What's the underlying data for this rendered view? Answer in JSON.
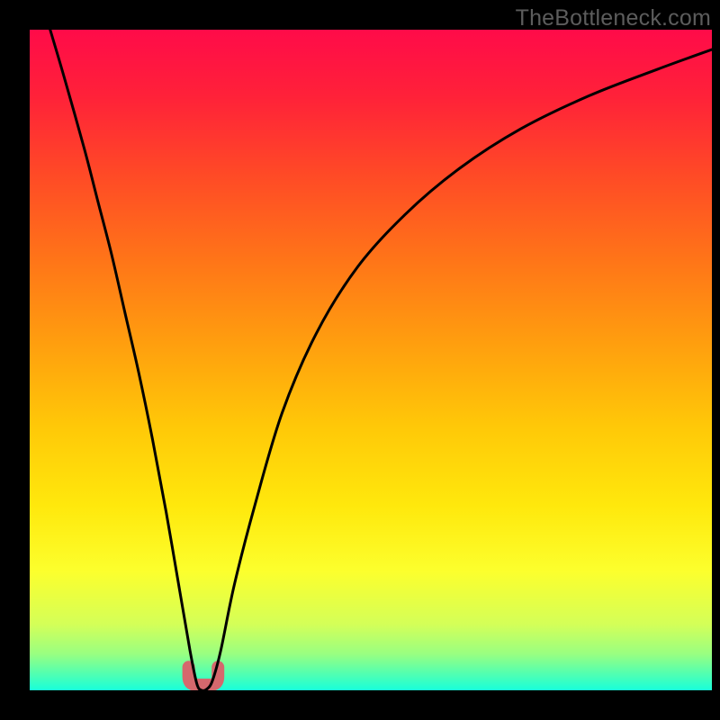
{
  "watermark": "TheBottleneck.com",
  "colors": {
    "gradient_stops": [
      {
        "offset": 0.0,
        "color": "#ff0b49"
      },
      {
        "offset": 0.1,
        "color": "#ff2139"
      },
      {
        "offset": 0.22,
        "color": "#ff4a26"
      },
      {
        "offset": 0.35,
        "color": "#ff7518"
      },
      {
        "offset": 0.48,
        "color": "#ffa00e"
      },
      {
        "offset": 0.6,
        "color": "#ffc808"
      },
      {
        "offset": 0.72,
        "color": "#ffe80c"
      },
      {
        "offset": 0.82,
        "color": "#fcff2d"
      },
      {
        "offset": 0.9,
        "color": "#d4ff58"
      },
      {
        "offset": 0.945,
        "color": "#99ff81"
      },
      {
        "offset": 0.97,
        "color": "#5dffa9"
      },
      {
        "offset": 1.0,
        "color": "#18ffda"
      }
    ],
    "curve": "#000000",
    "highlight": "#d5686d",
    "frame": "#000000"
  },
  "chart_data": {
    "type": "line",
    "title": "",
    "xlabel": "",
    "ylabel": "",
    "xlim": [
      0,
      100
    ],
    "ylim": [
      0,
      100
    ],
    "grid": false,
    "legend": false,
    "series": [
      {
        "name": "bottleneck-curve",
        "x": [
          3,
          5,
          8,
          10,
          12,
          14,
          16,
          18,
          20,
          22,
          23.5,
          24.5,
          25.2,
          26.0,
          26.8,
          28,
          30,
          33,
          37,
          42,
          48,
          55,
          63,
          72,
          82,
          92,
          100
        ],
        "y": [
          100,
          93,
          82,
          74,
          66,
          57,
          48,
          38,
          27,
          15,
          6,
          1,
          0,
          0.2,
          1.5,
          6,
          16,
          28,
          42,
          54,
          64,
          72,
          79,
          85,
          90,
          94,
          97
        ]
      }
    ],
    "annotations": [
      {
        "name": "highlight-u",
        "shape": "u",
        "x_range": [
          23.3,
          27.6
        ],
        "y_range": [
          0,
          3.5
        ]
      }
    ]
  }
}
